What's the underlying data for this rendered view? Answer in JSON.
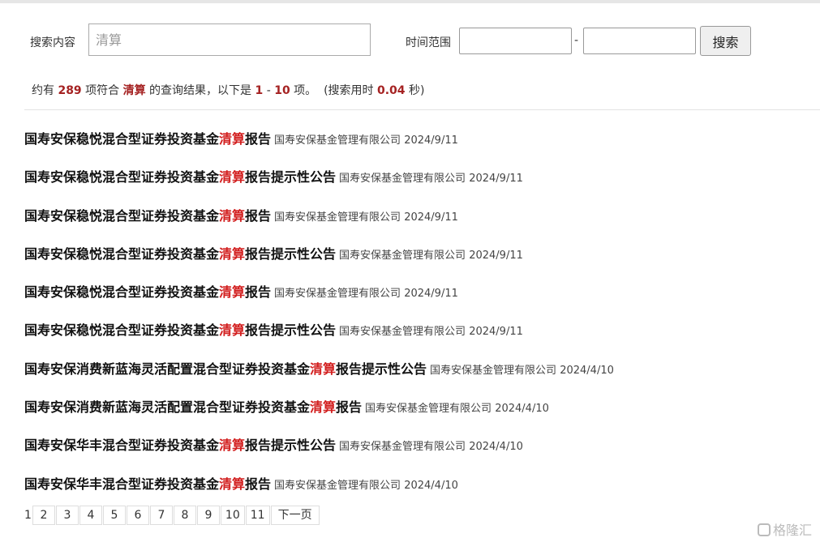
{
  "search": {
    "content_label": "搜索内容",
    "keyword_placeholder": "清算",
    "time_label": "时间范围",
    "date_separator": "-",
    "button_label": "搜索"
  },
  "summary": {
    "prefix": "约有",
    "count": "289",
    "mid1": "项符合",
    "keyword": "清算",
    "mid2": "的查询结果，以下是",
    "range_start": "1",
    "range_dash": "-",
    "range_end": "10",
    "mid3": "项。",
    "time_prefix": "(搜索用时",
    "time_value": "0.04",
    "time_suffix": "秒)"
  },
  "results": [
    {
      "title_pre": "国寿安保稳悦混合型证券投资基金",
      "keyword": "清算",
      "title_post": "报告",
      "publisher": "国寿安保基金管理有限公司",
      "date": "2024/9/11"
    },
    {
      "title_pre": "国寿安保稳悦混合型证券投资基金",
      "keyword": "清算",
      "title_post": "报告提示性公告",
      "publisher": "国寿安保基金管理有限公司",
      "date": "2024/9/11"
    },
    {
      "title_pre": "国寿安保稳悦混合型证券投资基金",
      "keyword": "清算",
      "title_post": "报告",
      "publisher": "国寿安保基金管理有限公司",
      "date": "2024/9/11"
    },
    {
      "title_pre": "国寿安保稳悦混合型证券投资基金",
      "keyword": "清算",
      "title_post": "报告提示性公告",
      "publisher": "国寿安保基金管理有限公司",
      "date": "2024/9/11"
    },
    {
      "title_pre": "国寿安保稳悦混合型证券投资基金",
      "keyword": "清算",
      "title_post": "报告",
      "publisher": "国寿安保基金管理有限公司",
      "date": "2024/9/11"
    },
    {
      "title_pre": "国寿安保稳悦混合型证券投资基金",
      "keyword": "清算",
      "title_post": "报告提示性公告",
      "publisher": "国寿安保基金管理有限公司",
      "date": "2024/9/11"
    },
    {
      "title_pre": "国寿安保消费新蓝海灵活配置混合型证券投资基金",
      "keyword": "清算",
      "title_post": "报告提示性公告",
      "publisher": "国寿安保基金管理有限公司",
      "date": "2024/4/10"
    },
    {
      "title_pre": "国寿安保消费新蓝海灵活配置混合型证券投资基金",
      "keyword": "清算",
      "title_post": "报告",
      "publisher": "国寿安保基金管理有限公司",
      "date": "2024/4/10"
    },
    {
      "title_pre": "国寿安保华丰混合型证券投资基金",
      "keyword": "清算",
      "title_post": "报告提示性公告",
      "publisher": "国寿安保基金管理有限公司",
      "date": "2024/4/10"
    },
    {
      "title_pre": "国寿安保华丰混合型证券投资基金",
      "keyword": "清算",
      "title_post": "报告",
      "publisher": "国寿安保基金管理有限公司",
      "date": "2024/4/10"
    }
  ],
  "pagination": {
    "current": "1",
    "pages": [
      "2",
      "3",
      "4",
      "5",
      "6",
      "7",
      "8",
      "9",
      "10",
      "11"
    ],
    "next_label": "下一页"
  },
  "watermark": {
    "text": "格隆汇",
    "icon": "gelonghui-logo-icon"
  },
  "colors": {
    "keyword_highlight": "#d21f1f",
    "summary_highlight": "#a52222"
  }
}
